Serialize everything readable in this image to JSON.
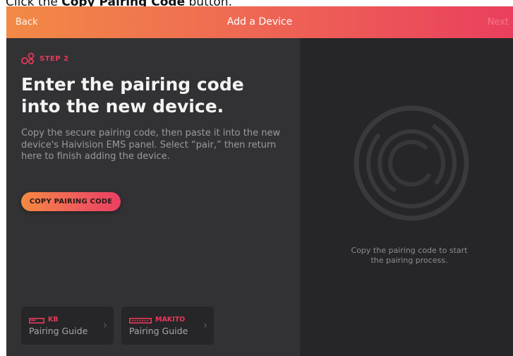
{
  "instruction": {
    "prefix": "Click the ",
    "target": "Copy Pairing Code",
    "suffix": " button."
  },
  "nav": {
    "back_label": "Back",
    "title": "Add a Device",
    "next_label": "Next"
  },
  "step": {
    "label": "STEP 2",
    "icon": "pairing-link-icon"
  },
  "main": {
    "headline_line1": "Enter the pairing code",
    "headline_line2": "into the new device.",
    "description": "Copy the secure pairing code, then paste it into the new device's Haivision EMS panel. Select “pair,” then return here to finish adding the device.",
    "copy_button_label": "COPY PAIRING CODE"
  },
  "guides": [
    {
      "model": "KB",
      "label": "Pairing Guide",
      "icon": "device-outline-icon"
    },
    {
      "model": "MAKITO",
      "label": "Pairing Guide",
      "icon": "device-outline-icon"
    }
  ],
  "right_panel": {
    "message_line1": "Copy the pairing code to start",
    "message_line2": "the pairing process.",
    "icon": "spinner-rings-icon"
  },
  "colors": {
    "accent": "#e8375a",
    "gradient_start": "#f28a45",
    "gradient_end": "#ea3f5e",
    "left_panel_bg": "#323234",
    "right_panel_bg": "#262628"
  }
}
